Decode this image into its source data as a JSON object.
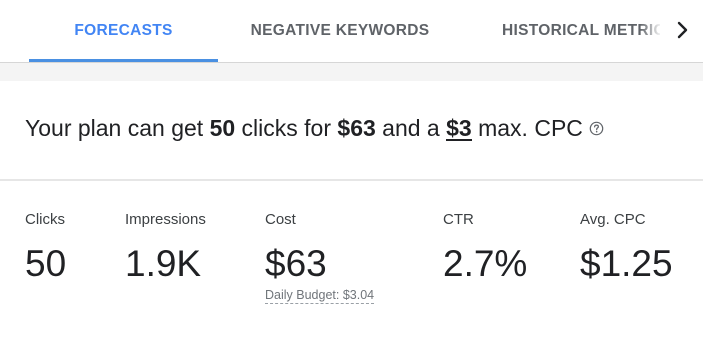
{
  "tabs": {
    "forecasts": "FORECASTS",
    "negative_keywords": "NEGATIVE KEYWORDS",
    "historical_metrics": "HISTORICAL METRICS"
  },
  "summary": {
    "prefix": "Your plan can get ",
    "clicks": "50",
    "mid1": " clicks for ",
    "cost": "$63",
    "mid2": " and a ",
    "cpc": "$3",
    "suffix": " max. CPC"
  },
  "metrics": {
    "clicks": {
      "label": "Clicks",
      "value": "50"
    },
    "impressions": {
      "label": "Impressions",
      "value": "1.9K"
    },
    "cost": {
      "label": "Cost",
      "value": "$63",
      "budget": "Daily Budget: $3.04"
    },
    "ctr": {
      "label": "CTR",
      "value": "2.7%"
    },
    "avg_cpc": {
      "label": "Avg. CPC",
      "value": "$1.25"
    }
  },
  "icons": {
    "help": "help-circle-icon",
    "next": "chevron-right-icon"
  },
  "colors": {
    "active_tab": "#4285f4",
    "tab_text": "#5f6368",
    "text": "#202124"
  }
}
